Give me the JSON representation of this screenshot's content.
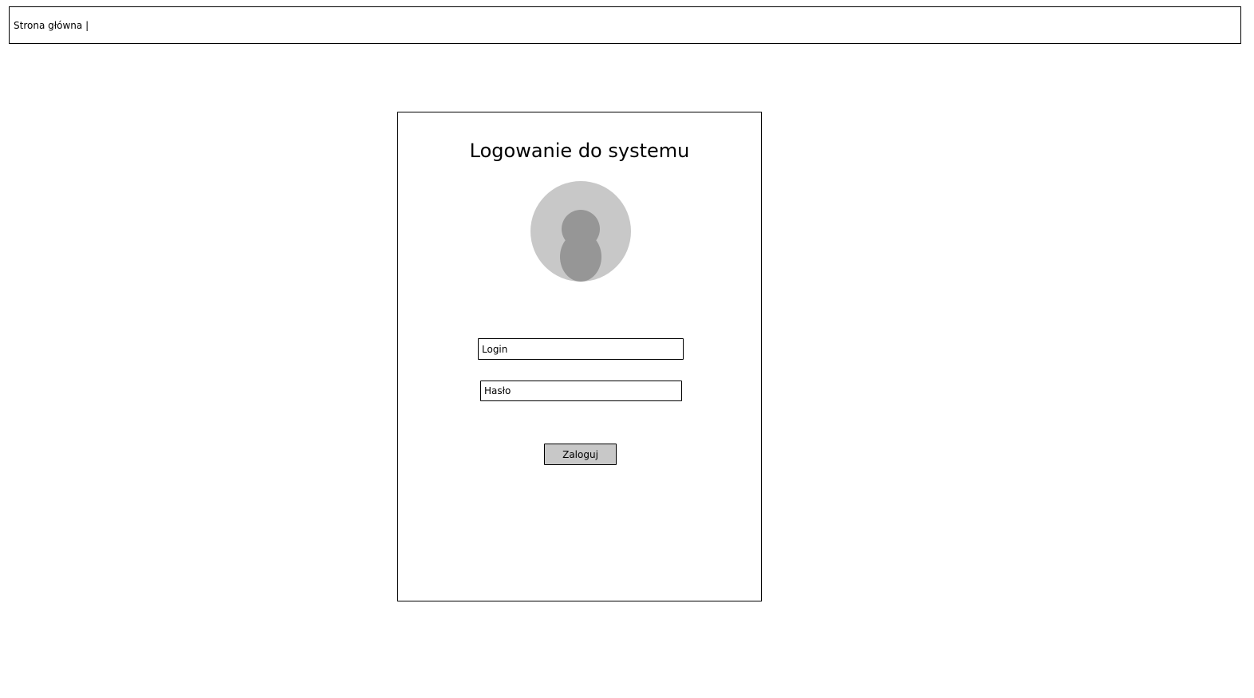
{
  "header": {
    "breadcrumb": "Strona główna |"
  },
  "login_panel": {
    "title": "Logowanie do systemu",
    "avatar_icon": "user-avatar-icon",
    "login_field": {
      "placeholder": "Login",
      "value": ""
    },
    "password_field": {
      "placeholder": "Hasło",
      "value": ""
    },
    "submit_label": "Zaloguj"
  },
  "colors": {
    "border": "#000000",
    "avatar_background": "#c8c8c8",
    "avatar_figure": "#969696",
    "button_background": "#c8c8c8"
  }
}
